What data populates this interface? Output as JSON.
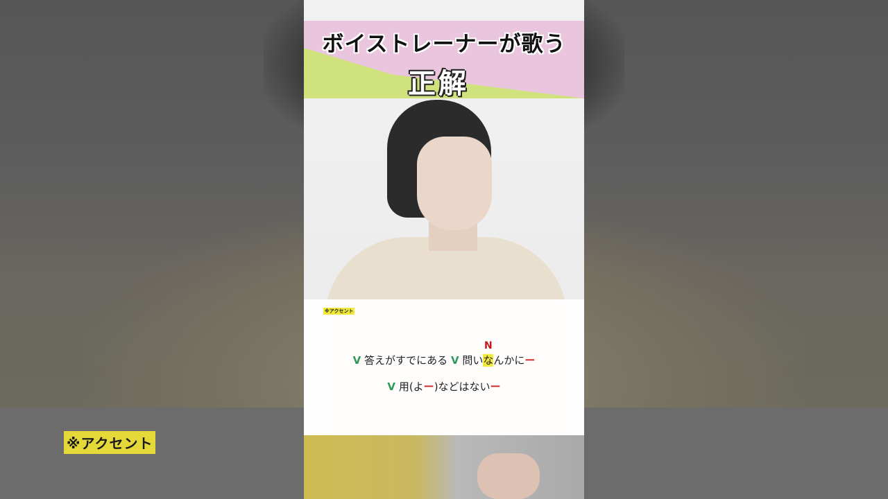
{
  "title": {
    "main": "ボイストレーナーが歌う",
    "sub": "正解"
  },
  "accent_tag": "※アクセント",
  "lyrics": {
    "line1": {
      "v1": "V",
      "seg1": "答えがすでにある",
      "v2": "V",
      "seg2a": "問い",
      "highlight": "な",
      "n_mark": "N",
      "seg2b": "んかに",
      "dash": "ー"
    },
    "line2": {
      "v": "V",
      "seg1": "用(よ",
      "dash1": "ー",
      "seg2": ")などはない",
      "dash2": "ー"
    }
  },
  "colors": {
    "band_pink": "#eac6de",
    "band_green": "#cfe27e",
    "v_mark": "#2f9a5a",
    "dash_red": "#d21f1f",
    "highlight_yellow": "#f3ea3a"
  }
}
